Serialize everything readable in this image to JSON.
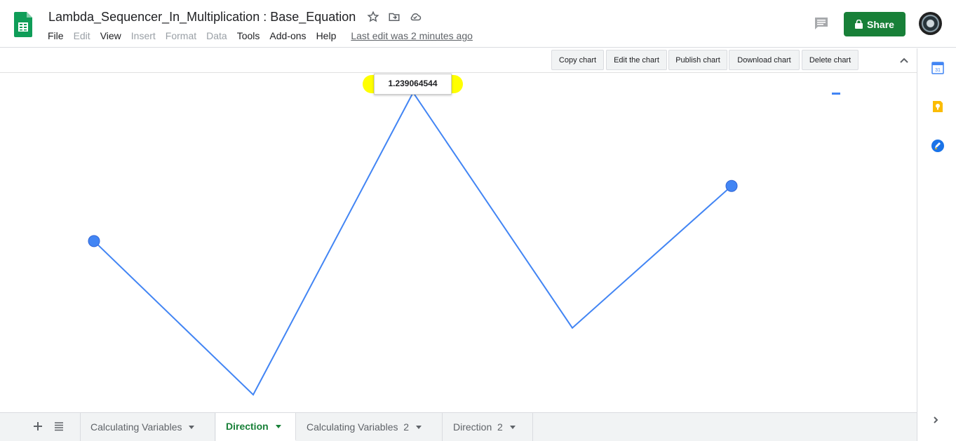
{
  "document": {
    "title": "Lambda_Sequencer_In_Multiplication : Base_Equation",
    "last_edit": "Last edit was 2 minutes ago"
  },
  "menu": [
    {
      "label": "File",
      "enabled": true
    },
    {
      "label": "Edit",
      "enabled": false
    },
    {
      "label": "View",
      "enabled": true
    },
    {
      "label": "Insert",
      "enabled": false
    },
    {
      "label": "Format",
      "enabled": false
    },
    {
      "label": "Data",
      "enabled": false
    },
    {
      "label": "Tools",
      "enabled": true
    },
    {
      "label": "Add-ons",
      "enabled": true
    },
    {
      "label": "Help",
      "enabled": true
    }
  ],
  "header": {
    "share_label": "Share",
    "share_color": "#188038",
    "icons": [
      "star-icon",
      "move-to-folder-icon",
      "cloud-status-icon",
      "comment-icon",
      "lock-icon"
    ]
  },
  "chart_toolbar": {
    "buttons": [
      "Copy chart",
      "Edit the chart",
      "Publish chart",
      "Download chart",
      "Delete chart"
    ]
  },
  "chart_data": {
    "type": "line",
    "series": [
      {
        "values": [
          0.35,
          -0.57,
          1.239064544,
          -0.17,
          0.68
        ],
        "color": "#4285f4"
      }
    ],
    "highlighted_point_index": 2,
    "tooltip_value": "1.239064544",
    "grid": false,
    "legend": "top-right"
  },
  "sheet_tabs": [
    {
      "label": "Calculating Variables",
      "active": false
    },
    {
      "label": "Direction",
      "active": true
    },
    {
      "label": "Calculating Variables  2",
      "active": false
    },
    {
      "label": "Direction  2",
      "active": false
    }
  ],
  "side_panel": {
    "icons": [
      "calendar-icon",
      "keep-icon",
      "tasks-icon"
    ],
    "calendar_day": "31"
  }
}
